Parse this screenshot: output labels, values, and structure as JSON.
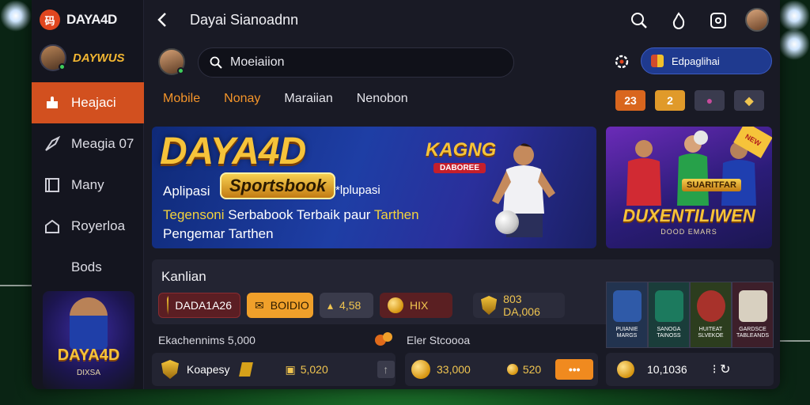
{
  "app": {
    "brand": "DAYA4D",
    "brand_badge": "码"
  },
  "sidebar": {
    "user_tag": "DAYWUS",
    "items": [
      {
        "label": "Heajaci",
        "icon": "puzzle-icon"
      },
      {
        "label": "Meagia 07",
        "icon": "soccer-icon"
      },
      {
        "label": "Many",
        "icon": "card-icon"
      },
      {
        "label": "Royerloa",
        "icon": "home-icon"
      },
      {
        "label": "Bods",
        "icon": ""
      }
    ],
    "promo": {
      "logo": "DAYA4D",
      "sub": "DIXSA"
    }
  },
  "header": {
    "title": "Dayai Sianoadnn"
  },
  "search": {
    "placeholder": "Moeiaiion"
  },
  "account": {
    "label": "Edpaglihai"
  },
  "tabs": [
    {
      "label": "Mobile"
    },
    {
      "label": "Nonay"
    },
    {
      "label": "Maraiian"
    },
    {
      "label": "Nenobon"
    }
  ],
  "chips": [
    "23",
    "2",
    "●",
    "◆"
  ],
  "hero": {
    "title": "DAYA4D",
    "badge": "Sportsbook",
    "line1a": "Aplipasi",
    "line1b": "*lplupasi",
    "line2_yellow": "Tegensoni",
    "line2_white": "Serbabook Terbaik paur",
    "line2_yellow2": "Tarthen",
    "line3": "Pengemar Tarthen",
    "tag": "KAGNG",
    "sub": "DABOREE"
  },
  "side_banner": {
    "ribbon": "NEW",
    "button": "SUARITFAR",
    "title": "DUXENTILIWEN",
    "sub": "DOOD EMARS"
  },
  "panel": {
    "title": "Kanlian",
    "buttons": [
      {
        "label": "DADA1A26",
        "style": "red"
      },
      {
        "label": "BOIDIO",
        "style": "orange"
      },
      {
        "label": "4,58",
        "style": "gray"
      },
      {
        "label": "HIX",
        "style": "red2"
      },
      {
        "label": "803  DA,006",
        "style": "dark"
      }
    ]
  },
  "tiles": [
    {
      "label": "PUIANIE MARGS",
      "color": "#2f5aa8"
    },
    {
      "label": "SANOGA TAINOSS",
      "color": "#1c7a5e"
    },
    {
      "label": "HUITEAT SLVEKOE",
      "color": "#3a7a2e"
    },
    {
      "label": "GARDSCE TABLEANDS",
      "color": "#a33a4a"
    }
  ],
  "bets": {
    "left_label": "Ekachennims 5,000",
    "right_label": "Eler Stcoooa",
    "row1": {
      "name": "Koapesy",
      "amount": "5,020",
      "icon": "arrow-up-icon"
    },
    "row2": {
      "amount": "33,000",
      "amount2": "520",
      "more": "•••"
    },
    "row3": {
      "amount": "10,1036"
    }
  }
}
